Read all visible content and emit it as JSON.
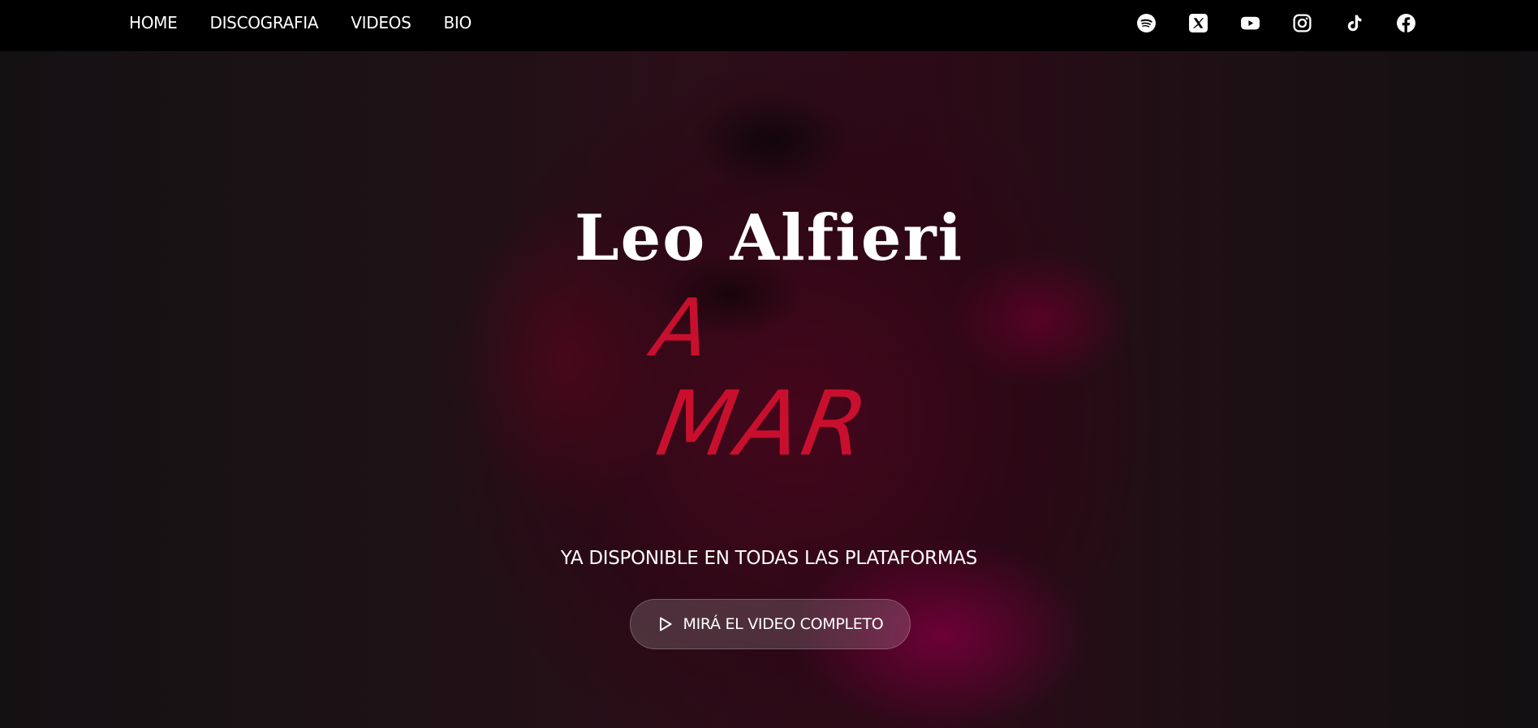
{
  "nav": {
    "links": [
      {
        "label": "HOME"
      },
      {
        "label": "DISCOGRAFIA"
      },
      {
        "label": "VIDEOS"
      },
      {
        "label": "BIO"
      }
    ],
    "social_icons": [
      "spotify-icon",
      "x-icon",
      "youtube-icon",
      "instagram-icon",
      "tiktok-icon",
      "facebook-icon"
    ]
  },
  "hero": {
    "artist_name": "Leo Alfieri",
    "single_title_line1": "A",
    "single_title_line2": "MAR",
    "tagline": "YA DISPONIBLE EN TODAS LAS PLATAFORMAS",
    "cta_label": "MIRÁ EL VIDEO COMPLETO",
    "cta_icon": "play-icon"
  },
  "colors": {
    "accent_red": "#c8102e",
    "nav_bg": "#000000",
    "text": "#ffffff"
  }
}
